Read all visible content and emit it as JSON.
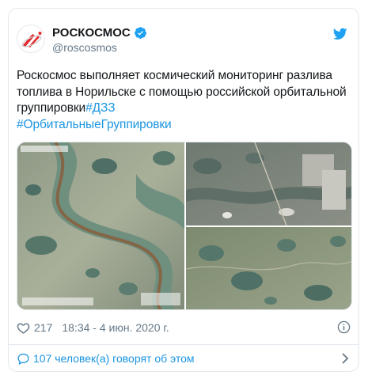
{
  "author": {
    "name": "РОСКОСМОС",
    "handle": "@roscosmos"
  },
  "tweet": {
    "text": "Роскосмос выполняет космический мониторинг разлива топлива в Норильске с помощью российской орбитальной группировки",
    "hashtags": [
      "#ДЗЗ",
      "#ОрбитальныеГруппировки"
    ]
  },
  "meta": {
    "likes": "217",
    "timestamp": "18:34 - 4 июн. 2020 г."
  },
  "footer": {
    "discussion": "107 человек(а) говорят об этом"
  },
  "icons": {
    "brand": "roscosmos-logo",
    "verified": "verified-badge-icon",
    "platform": "twitter-bird-icon",
    "like": "heart-icon",
    "info": "info-icon",
    "reply": "speech-bubble-icon",
    "more": "chevron-right-icon"
  },
  "colors": {
    "link": "#1b95e0",
    "text": "#14171a",
    "secondary": "#657786",
    "border": "#e1e8ed",
    "logo_red": "#e32a2e"
  }
}
